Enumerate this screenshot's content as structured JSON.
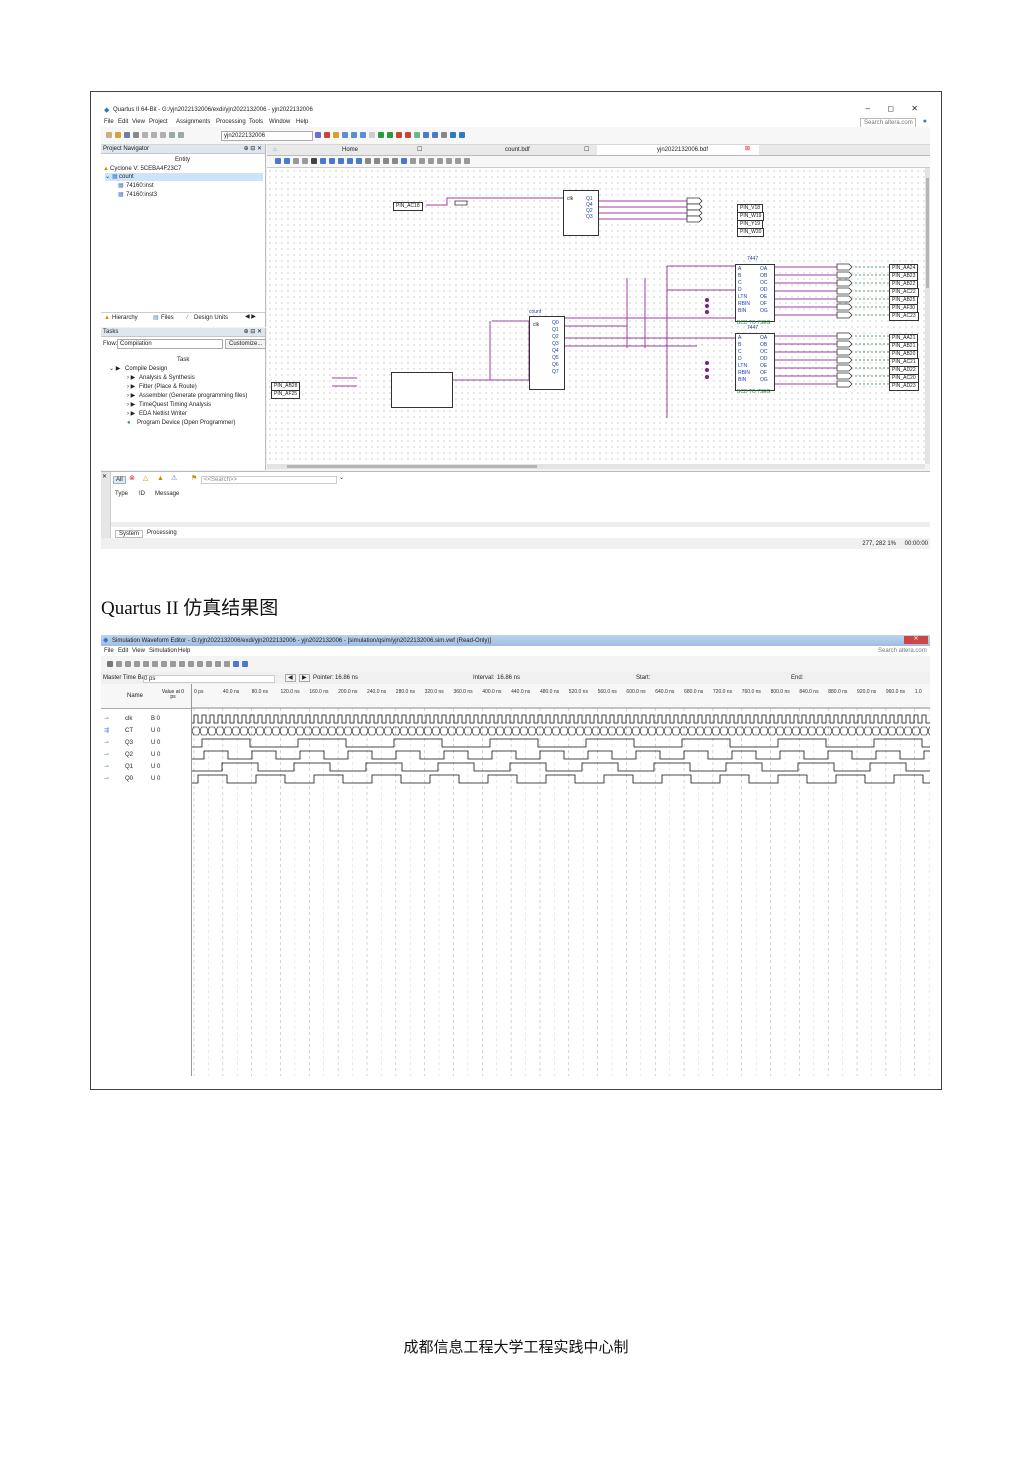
{
  "quartus": {
    "title": "Quartus II 64-Bit - G:/yjn2022132006/exdi/yjn2022132006 - yjn2022132006",
    "menu": [
      "File",
      "Edit",
      "View",
      "Project",
      "Assignments",
      "Processing",
      "Tools",
      "Window",
      "Help"
    ],
    "search_placeholder": "Search altera.com",
    "project_combo": "yjn2022132006",
    "navigator": {
      "header": "Project Navigator",
      "column": "Entity",
      "device": "Cyclone V: 5CEBA4F23C7",
      "items": [
        "count",
        "74160:inst",
        "74160:inst3"
      ],
      "tabs": [
        "Hierarchy",
        "Files",
        "Design Units"
      ]
    },
    "tasks": {
      "header": "Tasks",
      "flow_label": "Flow:",
      "flow_value": "Compilation",
      "customize": "Customize...",
      "column": "Task",
      "items": [
        "Compile Design",
        "Analysis & Synthesis",
        "Fitter (Place & Route)",
        "Assembler (Generate programming files)",
        "TimeQuest Timing Analysis",
        "EDA Netlist Writer",
        "Program Device (Open Programmer)"
      ]
    },
    "doc_tabs": [
      "Home",
      "count.bdf",
      "yjn2022132006.bdf"
    ],
    "schematic": {
      "pins_top": [
        "PIN_AC18"
      ],
      "pins_out_top": [
        "PIN_V18",
        "PIN_W19",
        "PIN_Y19",
        "PIN_W20"
      ],
      "pins_right1": [
        "PIN_AA24",
        "PIN_AB23",
        "PIN_AB22",
        "PIN_AC22",
        "PIN_AB25",
        "PIN_AF30",
        "PIN_AC23"
      ],
      "pins_right2": [
        "PIN_AA21",
        "PIN_AB21",
        "PIN_AB20",
        "PIN_AC21",
        "PIN_AD22",
        "PIN_AC20",
        "PIN_AD23"
      ],
      "pins_left": [
        "PIN_AB28",
        "PIN_AF25"
      ],
      "decoder_name": "7447",
      "decoder_label": "BCD TO 7SEG",
      "count_block": "count",
      "decoder_inputs": [
        "A",
        "B",
        "C",
        "D",
        "LTN",
        "RBIN",
        "BIN"
      ],
      "decoder_outputs": [
        "OA",
        "OB",
        "OC",
        "OD",
        "OE",
        "OF",
        "OG",
        "RBON"
      ],
      "counter_outputs": [
        "Q0",
        "Q1",
        "Q2",
        "Q3",
        "Q4",
        "Q5",
        "Q6",
        "Q7"
      ]
    },
    "messages": {
      "filter_all": "All",
      "search_placeholder": "<<Search>>",
      "columns": [
        "Type",
        "ID",
        "Message"
      ],
      "tabs": [
        "System",
        "Processing"
      ]
    },
    "status": {
      "zoom": "277, 282 1%",
      "time": "00:00:00"
    }
  },
  "caption": "Quartus II 仿真结果图",
  "sim": {
    "title": "Simulation Waveform Editor - G:/yjn2022132006/exdi/yjn2022132006 - yjn2022132006 - [simulation/qsim/yjn2022132006.sim.vwf (Read-Only)]",
    "menu": [
      "File",
      "Edit",
      "View",
      "Simulation",
      "Help"
    ],
    "search_placeholder": "Search altera.com",
    "master_label": "Master Time Bar:",
    "master_value": "0 ps",
    "pointer_label": "Pointer:",
    "pointer_value": "16.86 ns",
    "interval_label": "Interval:",
    "interval_value": "16.86 ns",
    "start_label": "Start:",
    "end_label": "End:",
    "col_name": "Name",
    "col_value": "Value at 0 ps",
    "time_ticks": [
      "0 ps",
      "40.0 ns",
      "80.0 ns",
      "120.0 ns",
      "160.0 ns",
      "200.0 ns",
      "240.0 ns",
      "280.0 ns",
      "320.0 ns",
      "360.0 ns",
      "400.0 ns",
      "440.0 ns",
      "480.0 ns",
      "520.0 ns",
      "560.0 ns",
      "600.0 ns",
      "640.0 ns",
      "680.0 ns",
      "720.0 ns",
      "760.0 ns",
      "800.0 ns",
      "840.0 ns",
      "880.0 ns",
      "920.0 ns",
      "960.0 ns",
      "1.0"
    ],
    "signals": [
      {
        "name": "clk",
        "value": "B 0"
      },
      {
        "name": "CT",
        "value": "U 0"
      },
      {
        "name": "Q3",
        "value": "U 0"
      },
      {
        "name": "Q2",
        "value": "U 0"
      },
      {
        "name": "Q1",
        "value": "U 0"
      },
      {
        "name": "Q0",
        "value": "U 0"
      }
    ]
  },
  "footer": "成都信息工程大学工程实践中心制"
}
